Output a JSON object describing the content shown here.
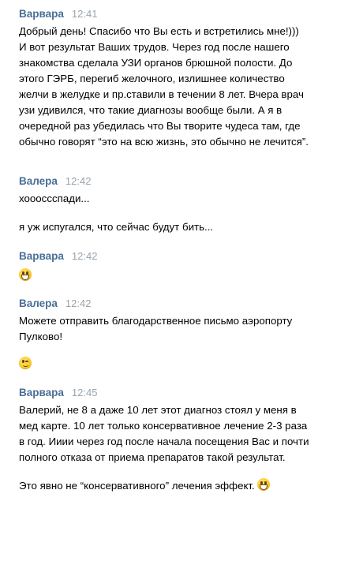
{
  "messages": [
    {
      "author": "Варвара",
      "time": "12:41",
      "lines": [
        "Добрый день! Спасибо что Вы есть и встретились мне!)))",
        "И вот результат Ваших трудов. Через год после нашего",
        "знакомства сделала УЗИ органов брюшной полости. До",
        "этого ГЭРБ, перегиб желочного, излишнее количество",
        "желчи в желудке и пр.ставили в течении 8 лет. Вчера врач",
        "узи удивился, что такие диагнозы вообще были. А я в",
        "очередной раз убедилась что Вы творите чудеса там, где",
        "обычно говорят “это на всю жизнь, это обычно не лечится”."
      ]
    },
    {
      "author": "Валера",
      "time": "12:42",
      "line_1": "хоооссспади...",
      "line_2": "я уж испугался, что сейчас будут бить..."
    },
    {
      "author": "Варвара",
      "time": "12:42",
      "emoji": "grinning-face-emoji"
    },
    {
      "author": "Валера",
      "time": "12:42",
      "lines": [
        "Можете отправить благодарственное письмо аэропорту",
        "Пулково!"
      ],
      "emoji": "winking-face-emoji"
    },
    {
      "author": "Варвара",
      "time": "12:45",
      "lines": [
        "Валерий, не 8 а даже 10 лет этот диагноз стоял у меня в",
        "мед карте. 10 лет только консервативное лечение 2-3 раза",
        "в год. Ииии через год после начала посещения Вас и почти",
        "полного отказа от приема препаратов такой результат."
      ],
      "last_line": "Это явно не “консервативного” лечения эффект.",
      "last_emoji": "grinning-face-emoji"
    }
  ],
  "colors": {
    "author": "#4a6e96",
    "time": "#9aa4ae",
    "text": "#000000",
    "background": "#ffffff"
  }
}
